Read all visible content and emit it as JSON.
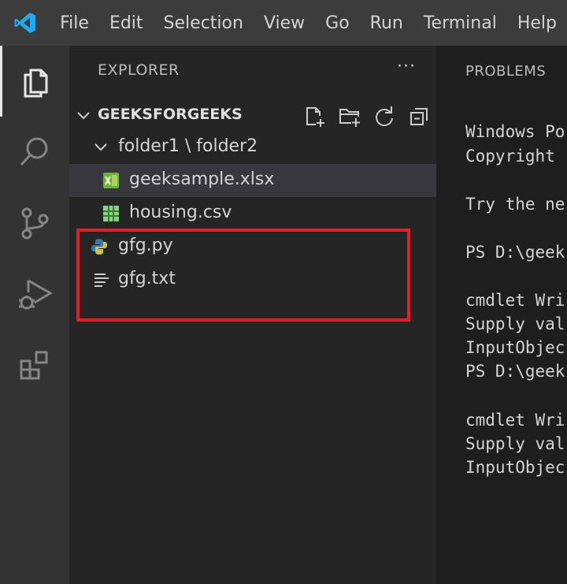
{
  "titlebar": {
    "menu": [
      "File",
      "Edit",
      "Selection",
      "View",
      "Go",
      "Run",
      "Terminal",
      "Help"
    ]
  },
  "activity_bar": {
    "items": [
      "explorer-icon",
      "search-icon",
      "source-control-icon",
      "run-debug-icon",
      "extensions-icon"
    ]
  },
  "explorer": {
    "header": "EXPLORER",
    "more": "···",
    "folder_name": "GEEKSFORGEEKS",
    "subfolder": "folder1 \\ folder2",
    "files": [
      {
        "name": "geeksample.xlsx",
        "icon": "excel-file-icon"
      },
      {
        "name": "housing.csv",
        "icon": "csv-file-icon"
      },
      {
        "name": "gfg.py",
        "icon": "python-file-icon"
      },
      {
        "name": "gfg.txt",
        "icon": "text-file-icon"
      }
    ]
  },
  "panel": {
    "tab": "PROBLEMS",
    "lines": [
      "Windows Po",
      "Copyright",
      "Try the ne",
      "PS D:\\geek",
      "cmdlet Wri",
      "Supply val",
      "InputObjec",
      "PS D:\\geek",
      "cmdlet Wri",
      "Supply val",
      "InputObjec"
    ]
  },
  "colors": {
    "titlebar": "#3c3c3c",
    "activitybar": "#333333",
    "sidebar": "#252526",
    "selection": "#37373d",
    "highlight": "#e41e26",
    "vscode_blue": "#23a9f2"
  }
}
